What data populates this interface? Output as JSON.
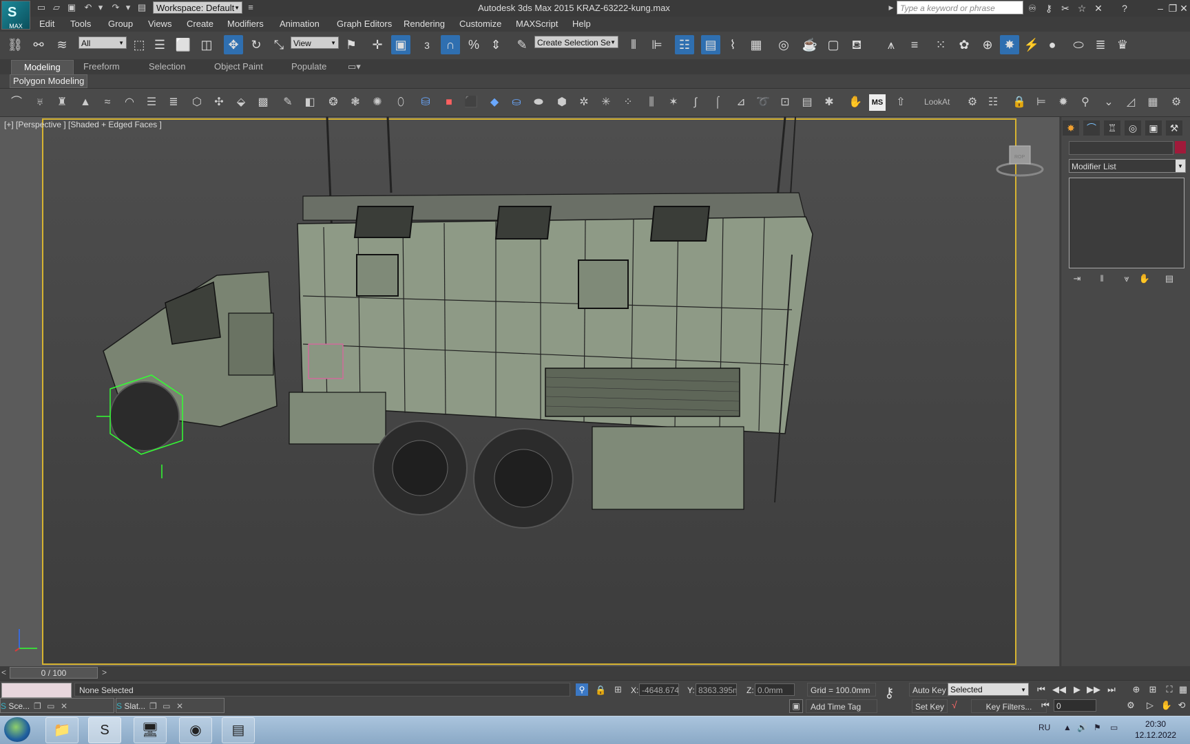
{
  "title_bar": {
    "logo_text": "MAX",
    "workspace": "Workspace: Default",
    "app_title": "Autodesk 3ds Max  2015     KRAZ-63222-kung.max",
    "search_placeholder": "Type a keyword or phrase"
  },
  "menu": [
    "Edit",
    "Tools",
    "Group",
    "Views",
    "Create",
    "Modifiers",
    "Animation",
    "Graph Editors",
    "Rendering",
    "Customize",
    "MAXScript",
    "Help"
  ],
  "main_toolbar": {
    "selection_filter": "All",
    "reference_coord": "View",
    "named_selection": "Create Selection Se",
    "snap_value": "3"
  },
  "ribbon": {
    "tabs": [
      "Modeling",
      "Freeform",
      "Selection",
      "Object Paint",
      "Populate"
    ],
    "active_tab": "Modeling",
    "panel_label": "Polygon Modeling"
  },
  "mod_toolbar": {
    "lookat_label": "LookAt"
  },
  "viewport": {
    "label": "[+] [Perspective ] [Shaded + Edged Faces ]",
    "frame_color": "#d7b431",
    "model_color": "#8e9a86",
    "selection_color": "#33ff33"
  },
  "command_panel": {
    "modifier_list": "Modifier List",
    "object_color": "#a01a3a"
  },
  "time_slider": {
    "position": "0 / 100",
    "left_arrow": "<",
    "right_arrow": ">"
  },
  "status": {
    "message": "None Selected",
    "x_label": "X:",
    "x_value": "-4648.674r",
    "y_label": "Y:",
    "y_value": "8363.395m",
    "z_label": "Z:",
    "z_value": "0.0mm",
    "grid": "Grid = 100.0mm",
    "add_time_tag": "Add Time Tag",
    "auto_key": "Auto Key",
    "set_key": "Set Key",
    "key_mode": "Selected",
    "key_filters": "Key Filters...",
    "current_frame": "0"
  },
  "mini_windows": [
    {
      "label": "Sce..."
    },
    {
      "label": "Slat..."
    }
  ],
  "taskbar": {
    "language": "RU",
    "time": "20:30",
    "date": "12.12.2022"
  }
}
